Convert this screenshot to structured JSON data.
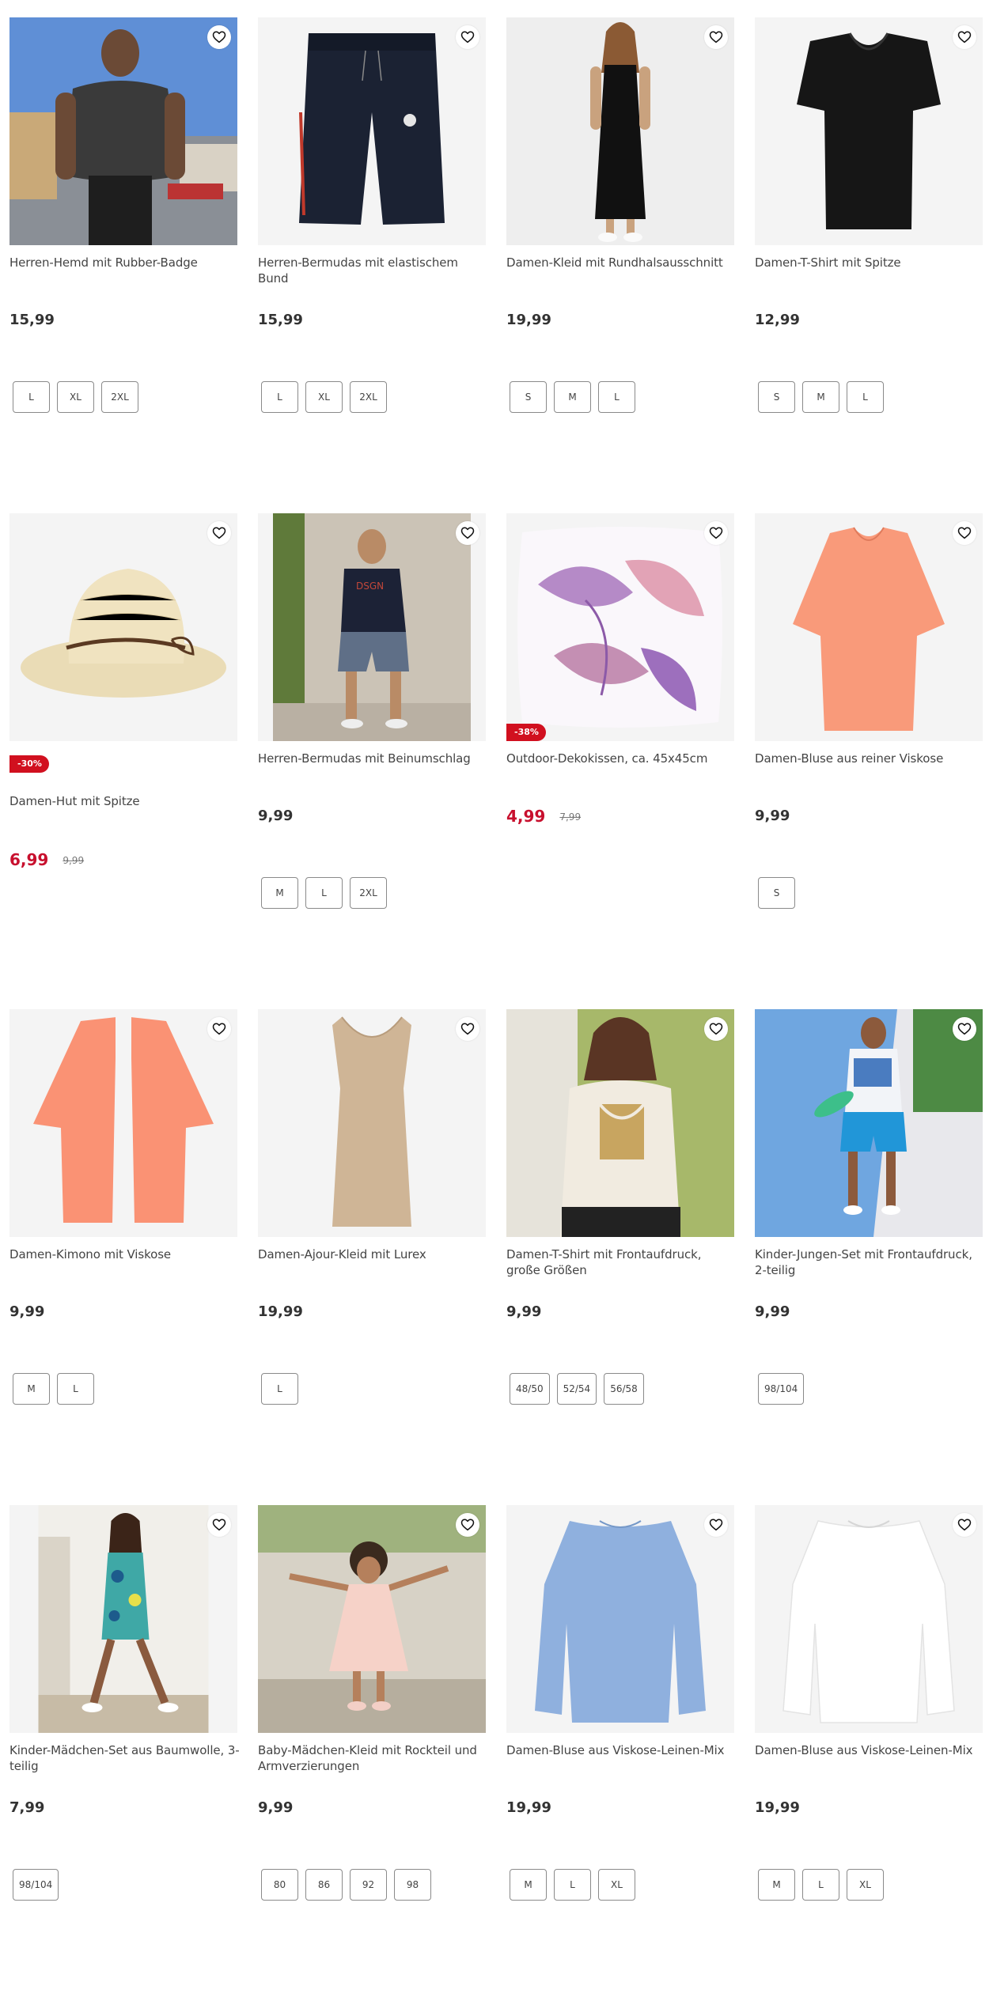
{
  "products": [
    {
      "name": "Herren-Hemd mit Rubber-Badge",
      "price": "15,99",
      "sizes": [
        "L",
        "XL",
        "2XL"
      ],
      "image": "man-shirt-photo"
    },
    {
      "name": "Herren-Bermudas mit elastischem Bund",
      "price": "15,99",
      "sizes": [
        "L",
        "XL",
        "2XL"
      ],
      "image": "navy-bermuda-shorts"
    },
    {
      "name": "Damen-Kleid mit Rundhalsausschnitt",
      "price": "19,99",
      "sizes": [
        "S",
        "M",
        "L"
      ],
      "image": "black-dress-photo"
    },
    {
      "name": "Damen-T-Shirt mit Spitze",
      "price": "12,99",
      "sizes": [
        "S",
        "M",
        "L"
      ],
      "image": "black-tshirt"
    },
    {
      "name": "Damen-Hut mit Spitze",
      "price": "6,99",
      "old_price": "9,99",
      "discount": "-30%",
      "sizes": [],
      "image": "straw-hat"
    },
    {
      "name": "Herren-Bermudas mit Beinumschlag",
      "price": "9,99",
      "sizes": [
        "M",
        "L",
        "2XL"
      ],
      "image": "man-bermuda-photo"
    },
    {
      "name": "Outdoor-Dekokissen, ca. 45x45cm",
      "price": "4,99",
      "old_price": "7,99",
      "discount": "-38%",
      "sizes": [],
      "image": "leaf-cushion"
    },
    {
      "name": "Damen-Bluse aus reiner Viskose",
      "price": "9,99",
      "sizes": [
        "S"
      ],
      "image": "coral-blouse"
    },
    {
      "name": "Damen-Kimono mit Viskose",
      "price": "9,99",
      "sizes": [
        "M",
        "L"
      ],
      "image": "coral-kimono"
    },
    {
      "name": "Damen-Ajour-Kleid mit Lurex",
      "price": "19,99",
      "sizes": [
        "L"
      ],
      "image": "beige-dress"
    },
    {
      "name": "Damen-T-Shirt mit Frontaufdruck, große Größen",
      "price": "9,99",
      "sizes": [
        "48/50",
        "52/54",
        "56/58"
      ],
      "image": "woman-print-tshirt-photo"
    },
    {
      "name": "Kinder-Jungen-Set mit Frontaufdruck, 2-teilig",
      "price": "9,99",
      "sizes": [
        "98/104"
      ],
      "image": "boy-set-photo"
    },
    {
      "name": "Kinder-Mädchen-Set aus Baumwolle, 3-teilig",
      "price": "7,99",
      "sizes": [
        "98/104"
      ],
      "image": "girl-set-photo"
    },
    {
      "name": "Baby-Mädchen-Kleid mit Rockteil und Armverzierungen",
      "price": "9,99",
      "sizes": [
        "80",
        "86",
        "92",
        "98"
      ],
      "image": "baby-dress-photo"
    },
    {
      "name": "Damen-Bluse aus Viskose-Leinen-Mix",
      "price": "19,99",
      "sizes": [
        "M",
        "L",
        "XL"
      ],
      "image": "blue-blouse"
    },
    {
      "name": "Damen-Bluse aus Viskose-Leinen-Mix",
      "price": "19,99",
      "sizes": [
        "M",
        "L",
        "XL"
      ],
      "image": "white-blouse"
    }
  ],
  "colors": {
    "sale": "#c8102e",
    "badge": "#d1101f",
    "text": "#333333",
    "image_bg": "#f4f4f4"
  }
}
